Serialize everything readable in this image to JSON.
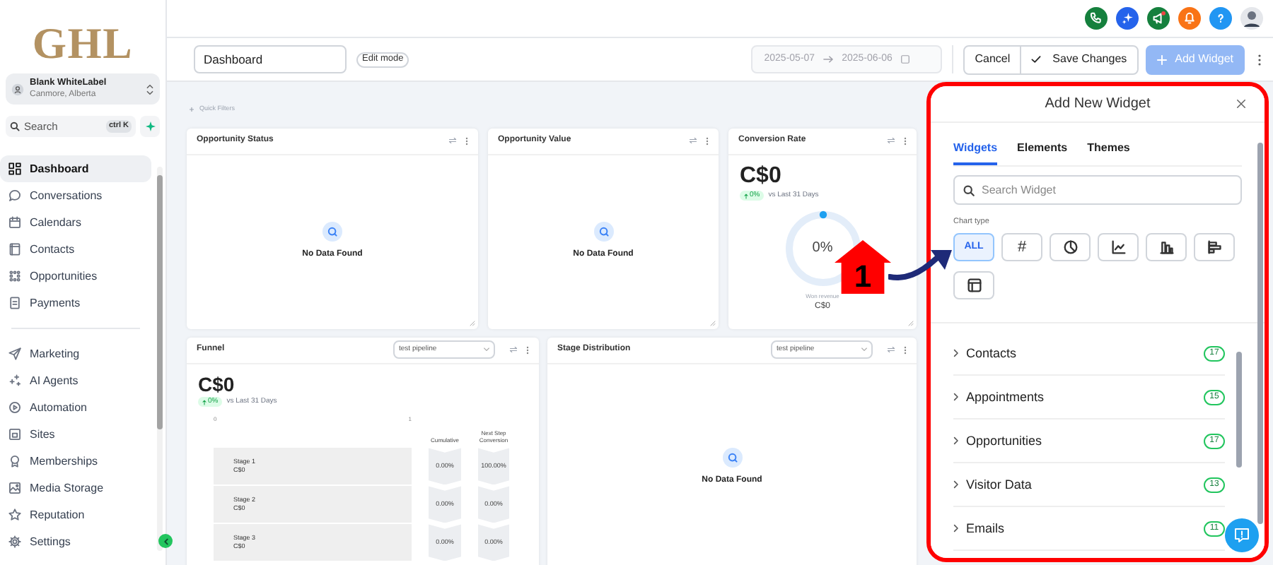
{
  "sidebar": {
    "logo": "GHL",
    "account": {
      "name": "Blank WhiteLabel",
      "location": "Canmore, Alberta"
    },
    "search": {
      "placeholder": "Search",
      "shortcut": "ctrl K"
    },
    "nav_groups": [
      [
        {
          "label": "Dashboard",
          "selected": true
        },
        {
          "label": "Conversations",
          "selected": false
        },
        {
          "label": "Calendars",
          "selected": false
        },
        {
          "label": "Contacts",
          "selected": false
        },
        {
          "label": "Opportunities",
          "selected": false
        },
        {
          "label": "Payments",
          "selected": false
        }
      ],
      [
        {
          "label": "Marketing",
          "selected": false
        },
        {
          "label": "AI Agents",
          "selected": false
        },
        {
          "label": "Automation",
          "selected": false
        },
        {
          "label": "Sites",
          "selected": false
        },
        {
          "label": "Memberships",
          "selected": false
        },
        {
          "label": "Media Storage",
          "selected": false
        },
        {
          "label": "Reputation",
          "selected": false
        },
        {
          "label": "Settings",
          "selected": false
        }
      ]
    ]
  },
  "toolbar": {
    "dashboard_name": "Dashboard",
    "mode": "Edit mode",
    "date_start": "2025-05-07",
    "date_end": "2025-06-06",
    "cancel": "Cancel",
    "save": "Save Changes",
    "add": "Add Widget"
  },
  "quick_filters": "Quick Filters",
  "widgets": [
    {
      "kind": "empty",
      "title": "Opportunity Status",
      "message": "No Data Found"
    },
    {
      "kind": "empty",
      "title": "Opportunity Value",
      "message": "No Data Found"
    },
    {
      "kind": "gauge",
      "title": "Conversion Rate",
      "value": "C$0",
      "change": "0%",
      "comparison": "vs Last 31 Days",
      "gauge_label": "0%",
      "caption": "Won revenue",
      "caption_value": "C$0"
    },
    {
      "kind": "funnel",
      "title": "Funnel",
      "select": "test pipeline",
      "value": "C$0",
      "change": "0%",
      "comparison": "vs Last 31 Days",
      "axis": [
        "0",
        "1"
      ],
      "columns": [
        "Cumulative",
        "Next Step Conversion"
      ],
      "stages": [
        {
          "name": "Stage 1",
          "value": "C$0",
          "cumulative": "0.00%",
          "next": "100.00%"
        },
        {
          "name": "Stage 2",
          "value": "C$0",
          "cumulative": "0.00%",
          "next": "0.00%"
        },
        {
          "name": "Stage 3",
          "value": "C$0",
          "cumulative": "0.00%",
          "next": "0.00%"
        }
      ]
    },
    {
      "kind": "empty",
      "title": "Stage Distribution",
      "select": "test pipeline",
      "message": "No Data Found"
    }
  ],
  "panel": {
    "title": "Add New Widget",
    "tabs": [
      {
        "label": "Widgets",
        "selected": true
      },
      {
        "label": "Elements",
        "selected": false
      },
      {
        "label": "Themes",
        "selected": false
      }
    ],
    "search_placeholder": "Search Widget",
    "chart_type_label": "Chart type",
    "chart_types": [
      {
        "kind": "all",
        "label": "ALL",
        "selected": true
      },
      {
        "kind": "number",
        "label": "#",
        "selected": false
      },
      {
        "kind": "pie",
        "selected": false
      },
      {
        "kind": "line",
        "selected": false
      },
      {
        "kind": "bar",
        "selected": false
      },
      {
        "kind": "hbar",
        "selected": false
      },
      {
        "kind": "table",
        "selected": false
      }
    ],
    "categories": [
      {
        "label": "Contacts",
        "count": "17"
      },
      {
        "label": "Appointments",
        "count": "15"
      },
      {
        "label": "Opportunities",
        "count": "17"
      },
      {
        "label": "Visitor Data",
        "count": "13"
      },
      {
        "label": "Emails",
        "count": "11"
      }
    ]
  },
  "annotation": {
    "marker": "1"
  }
}
